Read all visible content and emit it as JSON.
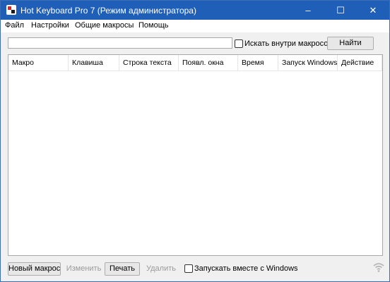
{
  "window": {
    "title": "Hot Keyboard Pro 7 (Режим администратора)",
    "controls": {
      "minimize": "–",
      "maximize": "☐",
      "close": "✕"
    }
  },
  "menu": {
    "items": [
      "Файл",
      "Настройки",
      "Общие макросы",
      "Помощь"
    ]
  },
  "search": {
    "value": "",
    "placeholder": "",
    "inside_macros_label": "Искать внутри макросов",
    "inside_macros_checked": false,
    "find_label": "Найти"
  },
  "table": {
    "columns": [
      "Макро",
      "Клавиша",
      "Строка текста",
      "Появл. окна",
      "Время",
      "Запуск Windows",
      "Действие"
    ],
    "rows": []
  },
  "footer": {
    "new_label": "Новый макрос",
    "edit_label": "Изменить",
    "print_label": "Печать",
    "delete_label": "Удалить",
    "startup_label": "Запускать вместе с Windows",
    "startup_checked": false,
    "edit_enabled": false,
    "delete_enabled": false
  },
  "colors": {
    "titlebar": "#1f5fb8",
    "accent": "#3b6fb5",
    "disabled_text": "#9a9a9a"
  },
  "icons": {
    "app": "hot-keyboard-app-icon",
    "status": "wifi-icon"
  }
}
